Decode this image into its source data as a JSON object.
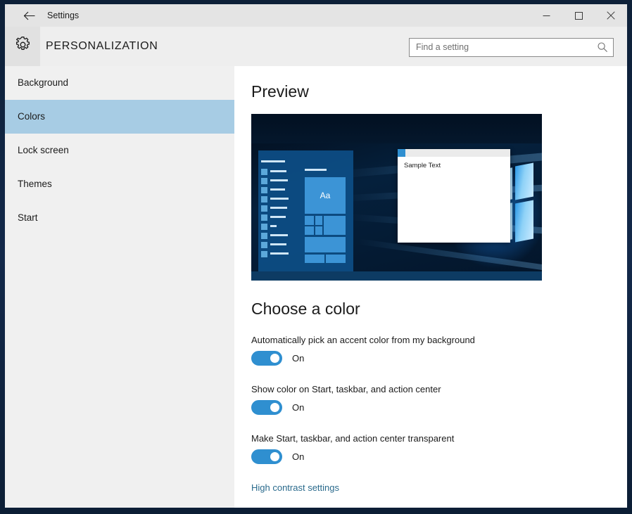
{
  "window": {
    "app_title": "Settings",
    "page_title": "PERSONALIZATION",
    "back_icon": "back-arrow-icon",
    "gear_icon": "gear-icon",
    "controls": {
      "minimize": "minimize-icon",
      "maximize": "maximize-icon",
      "close": "close-icon"
    },
    "frame_color": "#10243e"
  },
  "search": {
    "placeholder": "Find a setting",
    "icon": "search-icon"
  },
  "sidebar": {
    "selected": "Colors",
    "selected_color": "#a7cce4",
    "items": [
      {
        "label": "Background"
      },
      {
        "label": "Colors"
      },
      {
        "label": "Lock screen"
      },
      {
        "label": "Themes"
      },
      {
        "label": "Start"
      }
    ]
  },
  "content": {
    "preview_heading": "Preview",
    "choose_heading": "Choose a color",
    "preview": {
      "sample_window_text": "Sample Text",
      "tile_text": "Aa",
      "accent_color": "#2f8fd0"
    },
    "settings": [
      {
        "label": "Automatically pick an accent color from my background",
        "state": "On",
        "value": true
      },
      {
        "label": "Show color on Start, taskbar, and action center",
        "state": "On",
        "value": true
      },
      {
        "label": "Make Start, taskbar, and action center transparent",
        "state": "On",
        "value": true
      }
    ],
    "link": {
      "label": "High contrast settings",
      "color": "#2a6a8c"
    }
  }
}
